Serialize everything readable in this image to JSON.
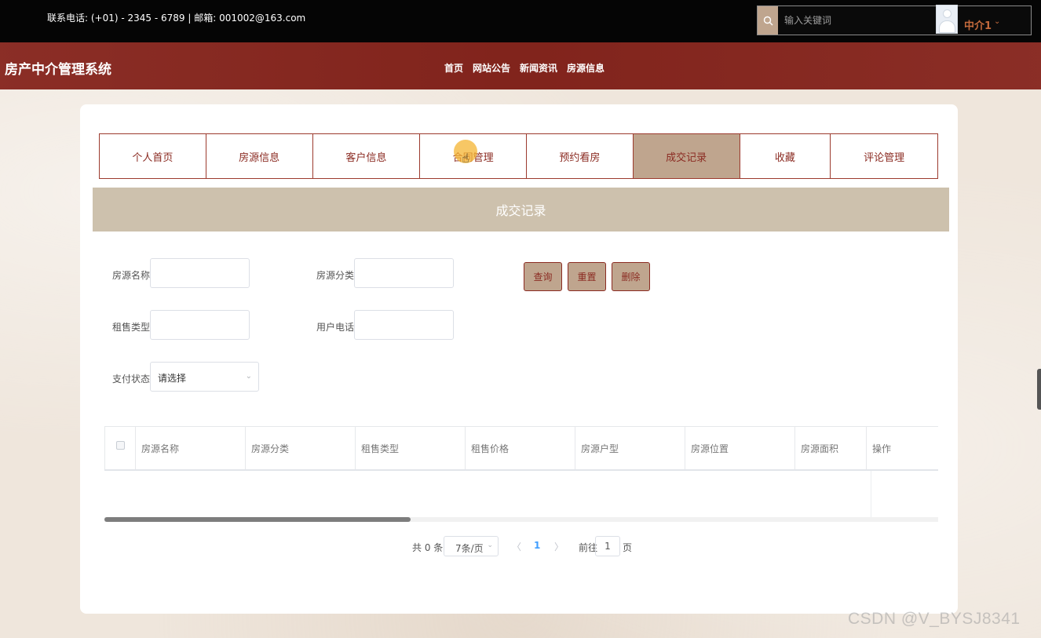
{
  "topbar": {
    "contact": "联系电话: (+01) - 2345 - 6789 | 邮箱: 001002@163.com",
    "search_placeholder": "输入关键词",
    "search_icon": "search-icon"
  },
  "header": {
    "brand": "房产中介管理系统",
    "nav": [
      "首页",
      "网站公告",
      "新闻资讯",
      "房源信息"
    ],
    "username": "中介1",
    "user_caret": "⌄"
  },
  "tabs": [
    {
      "label": "个人首页",
      "active": false
    },
    {
      "label": "房源信息",
      "active": false
    },
    {
      "label": "客户信息",
      "active": false
    },
    {
      "label": "合同管理",
      "active": false
    },
    {
      "label": "预约看房",
      "active": false
    },
    {
      "label": "成交记录",
      "active": true
    },
    {
      "label": "收藏",
      "active": false
    },
    {
      "label": "评论管理",
      "active": false
    }
  ],
  "section_title": "成交记录",
  "form": {
    "house_name_label": "房源名称",
    "house_category_label": "房源分类",
    "rent_sale_type_label": "租售类型",
    "user_phone_label": "用户电话",
    "pay_status_label": "支付状态",
    "pay_status_value": "请选择",
    "select_caret": "⌄"
  },
  "buttons": {
    "query": "查询",
    "reset": "重置",
    "delete": "删除"
  },
  "table": {
    "columns": [
      "房源名称",
      "房源分类",
      "租售类型",
      "租售价格",
      "房源户型",
      "房源位置",
      "房源面积",
      "操作"
    ],
    "rows": []
  },
  "pagination": {
    "total": "共 0 条",
    "page_size": "7条/页",
    "prev": "〈",
    "current": "1",
    "next": "〉",
    "goto_label": "前往",
    "goto_value": "1",
    "page_suffix": "页"
  },
  "watermark": "CSDN @V_BYSJ8341",
  "colors": {
    "topbar": "#050505",
    "header": "#86251d",
    "accent": "#bfa58e",
    "border_red": "#9c3a2e",
    "title_bar": "#cdc1ad",
    "pager_active": "#409eff"
  }
}
